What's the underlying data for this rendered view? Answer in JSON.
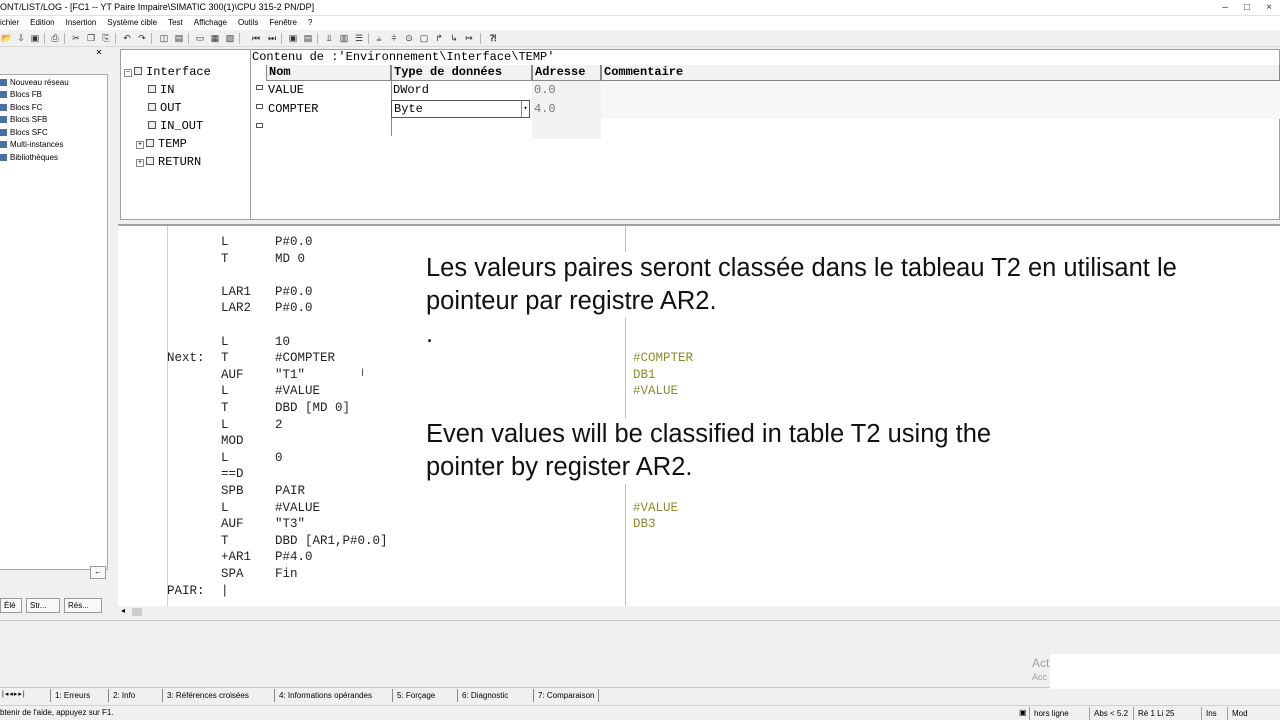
{
  "window": {
    "title": "ONT/LIST/LOG - [FC1 -- YT Paire Impaire\\SIMATIC 300(1)\\CPU 315-2 PN/DP]",
    "controls": [
      "–",
      "□",
      "×"
    ]
  },
  "menu": [
    "ichier",
    "Edition",
    "Insertion",
    "Système cible",
    "Test",
    "Affichage",
    "Outils",
    "Fenêtre",
    "?"
  ],
  "left_panel": {
    "items": [
      "Nouveau réseau",
      "Blocs FB",
      "Blocs FC",
      "Blocs SFB",
      "Blocs SFC",
      "Multi-instances",
      "Bibliothèques"
    ],
    "tabs": [
      "Élé",
      "Str...",
      "Rés..."
    ]
  },
  "interface": {
    "root": "Interface",
    "nodes": [
      "IN",
      "OUT",
      "IN_OUT",
      "TEMP",
      "RETURN"
    ],
    "content_path": "Contenu de :'Environnement\\Interface\\TEMP'",
    "columns": [
      "Nom",
      "Type de données",
      "Adresse",
      "Commentaire"
    ],
    "rows": [
      {
        "name": "VALUE",
        "type": "DWord",
        "address": "0.0",
        "comment": ""
      },
      {
        "name": "COMPTER",
        "type": "Byte",
        "address": "4.0",
        "comment": ""
      }
    ]
  },
  "code": {
    "lines": [
      {
        "label": "",
        "op": "L",
        "operand": "P#0.0"
      },
      {
        "label": "",
        "op": "T",
        "operand": "MD     0"
      },
      {
        "label": "",
        "op": "",
        "operand": ""
      },
      {
        "label": "",
        "op": "LAR1",
        "operand": "P#0.0"
      },
      {
        "label": "",
        "op": "LAR2",
        "operand": "P#0.0"
      },
      {
        "label": "",
        "op": "",
        "operand": ""
      },
      {
        "label": "",
        "op": "L",
        "operand": "10"
      },
      {
        "label": "Next:",
        "op": "T",
        "operand": "#COMPTER"
      },
      {
        "label": "",
        "op": "AUF",
        "operand": "\"T1\""
      },
      {
        "label": "",
        "op": "L",
        "operand": "#VALUE"
      },
      {
        "label": "",
        "op": "T",
        "operand": "DBD [MD 0]"
      },
      {
        "label": "",
        "op": "L",
        "operand": "2"
      },
      {
        "label": "",
        "op": "MOD",
        "operand": ""
      },
      {
        "label": "",
        "op": "L",
        "operand": "0"
      },
      {
        "label": "",
        "op": "==D",
        "operand": ""
      },
      {
        "label": "",
        "op": "SPB",
        "operand": "PAIR"
      },
      {
        "label": "",
        "op": "L",
        "operand": "#VALUE"
      },
      {
        "label": "",
        "op": "AUF",
        "operand": "\"T3\""
      },
      {
        "label": "",
        "op": "T",
        "operand": "DBD [AR1,P#0.0]"
      },
      {
        "label": "",
        "op": "+AR1",
        "operand": "P#4.0"
      },
      {
        "label": "",
        "op": "SPA",
        "operand": "Fin"
      },
      {
        "label": "PAIR:",
        "op": "|",
        "operand": ""
      }
    ],
    "comments": [
      {
        "line": 7,
        "text": "#COMPTER"
      },
      {
        "line": 8,
        "text": "DB1"
      },
      {
        "line": 9,
        "text": "#VALUE"
      },
      {
        "line": 16,
        "text": "#VALUE"
      },
      {
        "line": 17,
        "text": "DB3"
      }
    ]
  },
  "overlay": {
    "fr_line1": "Les valeurs paires seront classée dans le tableau T2 en utilisant le",
    "fr_line2": "pointeur par registre AR2.",
    "dot": ".",
    "en_line1": "Even values will be classified in table T2 using the",
    "en_line2": "pointer by register AR2."
  },
  "watermark": [
    "Act",
    "Acc"
  ],
  "bottom_tabs": [
    "1: Erreurs",
    "2: Info",
    "3: Références croisées",
    "4: Informations opérandes",
    "5: Forçage",
    "6: Diagnostic",
    "7: Comparaison"
  ],
  "status": {
    "help": "btenir de l'aide, appuyez sur F1.",
    "online": "hors ligne",
    "abs": "Abs < 5.2",
    "pos": "Ré 1 Li 25",
    "ins": "Ins",
    "mod": "Mod"
  }
}
